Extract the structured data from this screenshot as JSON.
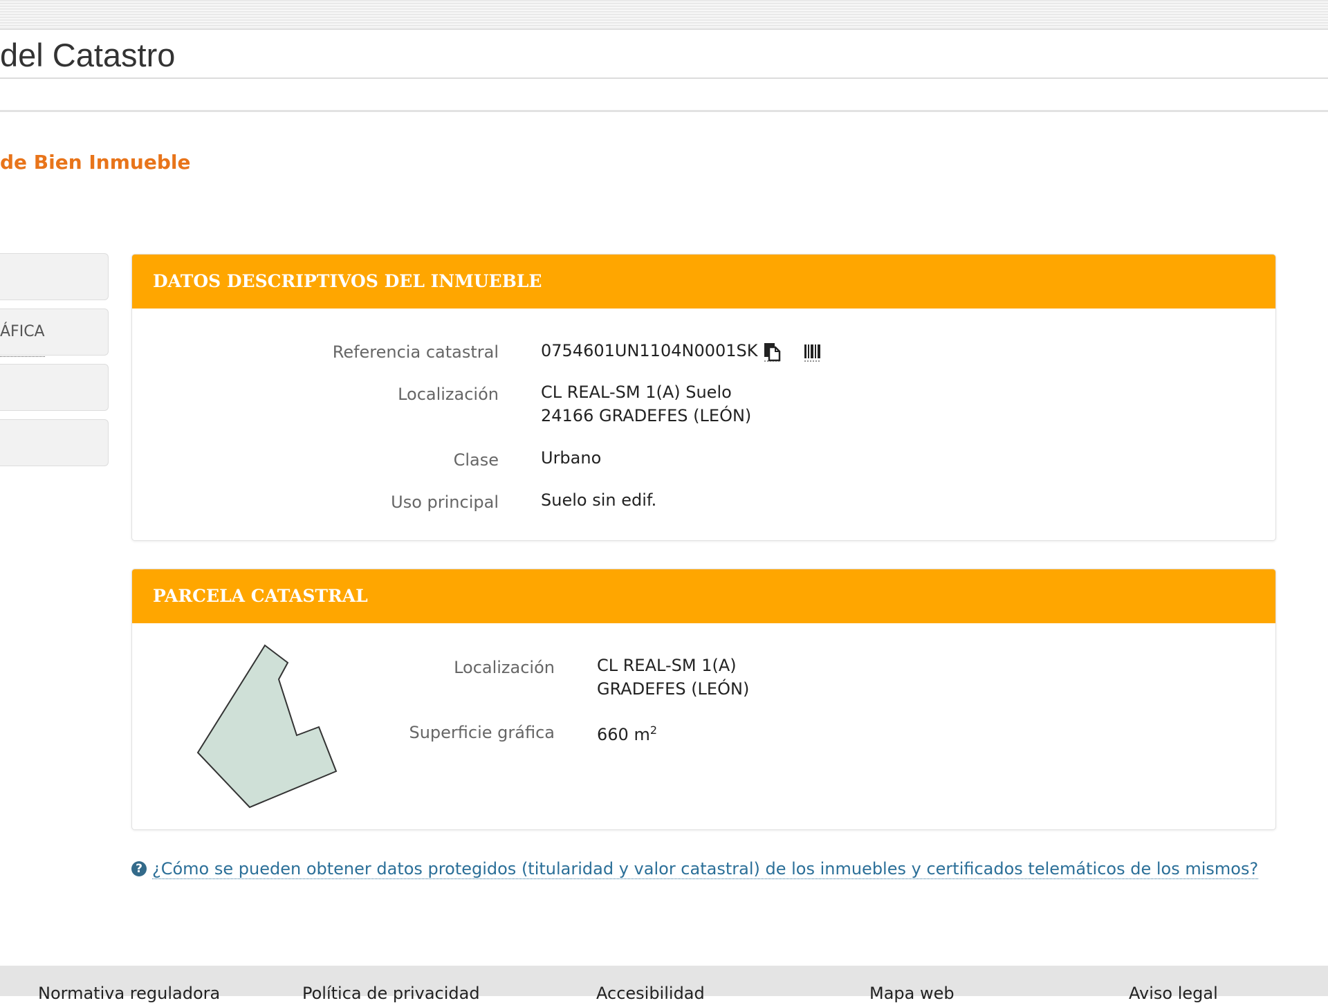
{
  "header": {
    "site_title": "del Catastro",
    "page_heading": "de Bien Inmueble"
  },
  "side_tabs": [
    {
      "label": ""
    },
    {
      "label": "ÁFICA"
    },
    {
      "label": ""
    },
    {
      "label": ""
    }
  ],
  "inmueble": {
    "title": "DATOS DESCRIPTIVOS DEL INMUEBLE",
    "ref_label": "Referencia catastral",
    "ref_value": "0754601UN1104N0001SK",
    "loc_label": "Localización",
    "loc_line1": "CL REAL-SM 1(A) Suelo",
    "loc_line2": "24166 GRADEFES (LEÓN)",
    "clase_label": "Clase",
    "clase_value": "Urbano",
    "uso_label": "Uso principal",
    "uso_value": "Suelo sin edif."
  },
  "parcela": {
    "title": "PARCELA CATASTRAL",
    "loc_label": "Localización",
    "loc_line1": "CL REAL-SM 1(A)",
    "loc_line2": "GRADEFES (LEÓN)",
    "sup_label": "Superficie gráfica",
    "sup_value": "660 m",
    "sup_unit_sup": "2",
    "shape_fill": "#cfe0d7"
  },
  "help": {
    "icon": "?",
    "text": "¿Cómo se pueden obtener datos protegidos (titularidad y valor catastral) de los inmuebles y certificados telemáticos de los mismos?"
  },
  "footer": {
    "links": [
      "Normativa reguladora",
      "Política de privacidad",
      "Accesibilidad",
      "Mapa web",
      "Aviso legal"
    ]
  },
  "colors": {
    "accent": "#ffa600",
    "heading": "#e8741a",
    "link": "#2b6f98"
  }
}
